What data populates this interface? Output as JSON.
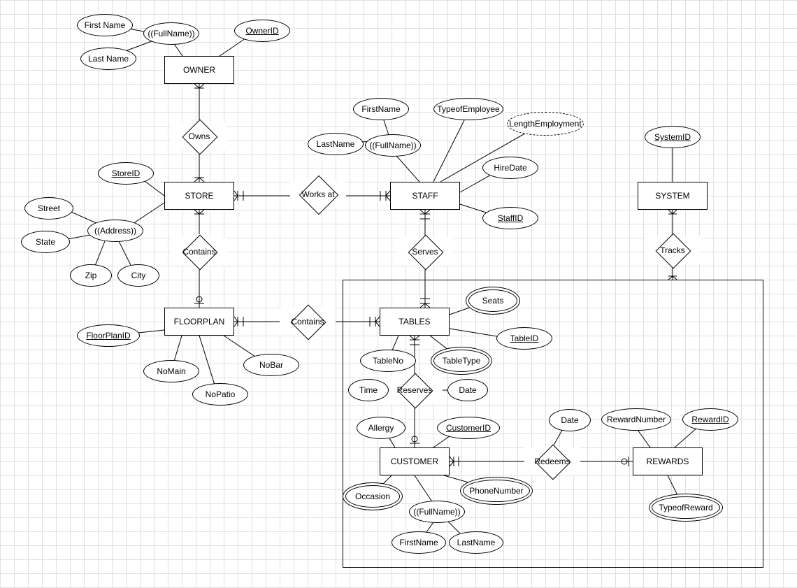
{
  "entities": {
    "owner": "OWNER",
    "store": "STORE",
    "staff": "STAFF",
    "system": "SYSTEM",
    "floorplan": "FLOORPLAN",
    "tables": "TABLES",
    "customer": "CUSTOMER",
    "rewards": "REWARDS"
  },
  "relationships": {
    "owns": "Owns",
    "works_at": "Works at",
    "contains_store": "Contains",
    "serves": "Serves",
    "contains_fp": "Contains",
    "reserves": "Reserves",
    "redeems": "Redeems",
    "tracks": "Tracks"
  },
  "attributes": {
    "owner": {
      "first_name": "First Name",
      "last_name": "Last Name",
      "full_name": "((FullName))",
      "owner_id": "OwnerID"
    },
    "store": {
      "store_id": "StoreID",
      "address": "((Address))",
      "street": "Street",
      "state": "State",
      "zip": "Zip",
      "city": "City"
    },
    "staff": {
      "first_name": "FirstName",
      "last_name": "LastName",
      "full_name": "((FullName))",
      "type_of_employee": "TypeofEmployee",
      "length_employment": "LengthEmployment",
      "hire_date": "HireDate",
      "staff_id": "StaffID"
    },
    "system": {
      "system_id": "SystemID"
    },
    "floorplan": {
      "floorplan_id": "FloorPlanID",
      "no_main": "NoMain",
      "no_patio": "NoPatio",
      "no_bar": "NoBar"
    },
    "tables": {
      "seats": "Seats",
      "table_id": "TableID",
      "table_no": "TableNo",
      "table_type": "TableType"
    },
    "reserves": {
      "time": "Time",
      "date": "Date"
    },
    "customer": {
      "allergy": "Allergy",
      "customer_id": "CustomerID",
      "occasion": "Occasion",
      "phone_number": "PhoneNumber",
      "full_name": "((FullName))",
      "first_name": "FirstName",
      "last_name": "LastName"
    },
    "redeems": {
      "date": "Date"
    },
    "rewards": {
      "reward_number": "RewardNumber",
      "reward_id": "RewardID",
      "type_of_reward": "TypeofReward"
    }
  }
}
